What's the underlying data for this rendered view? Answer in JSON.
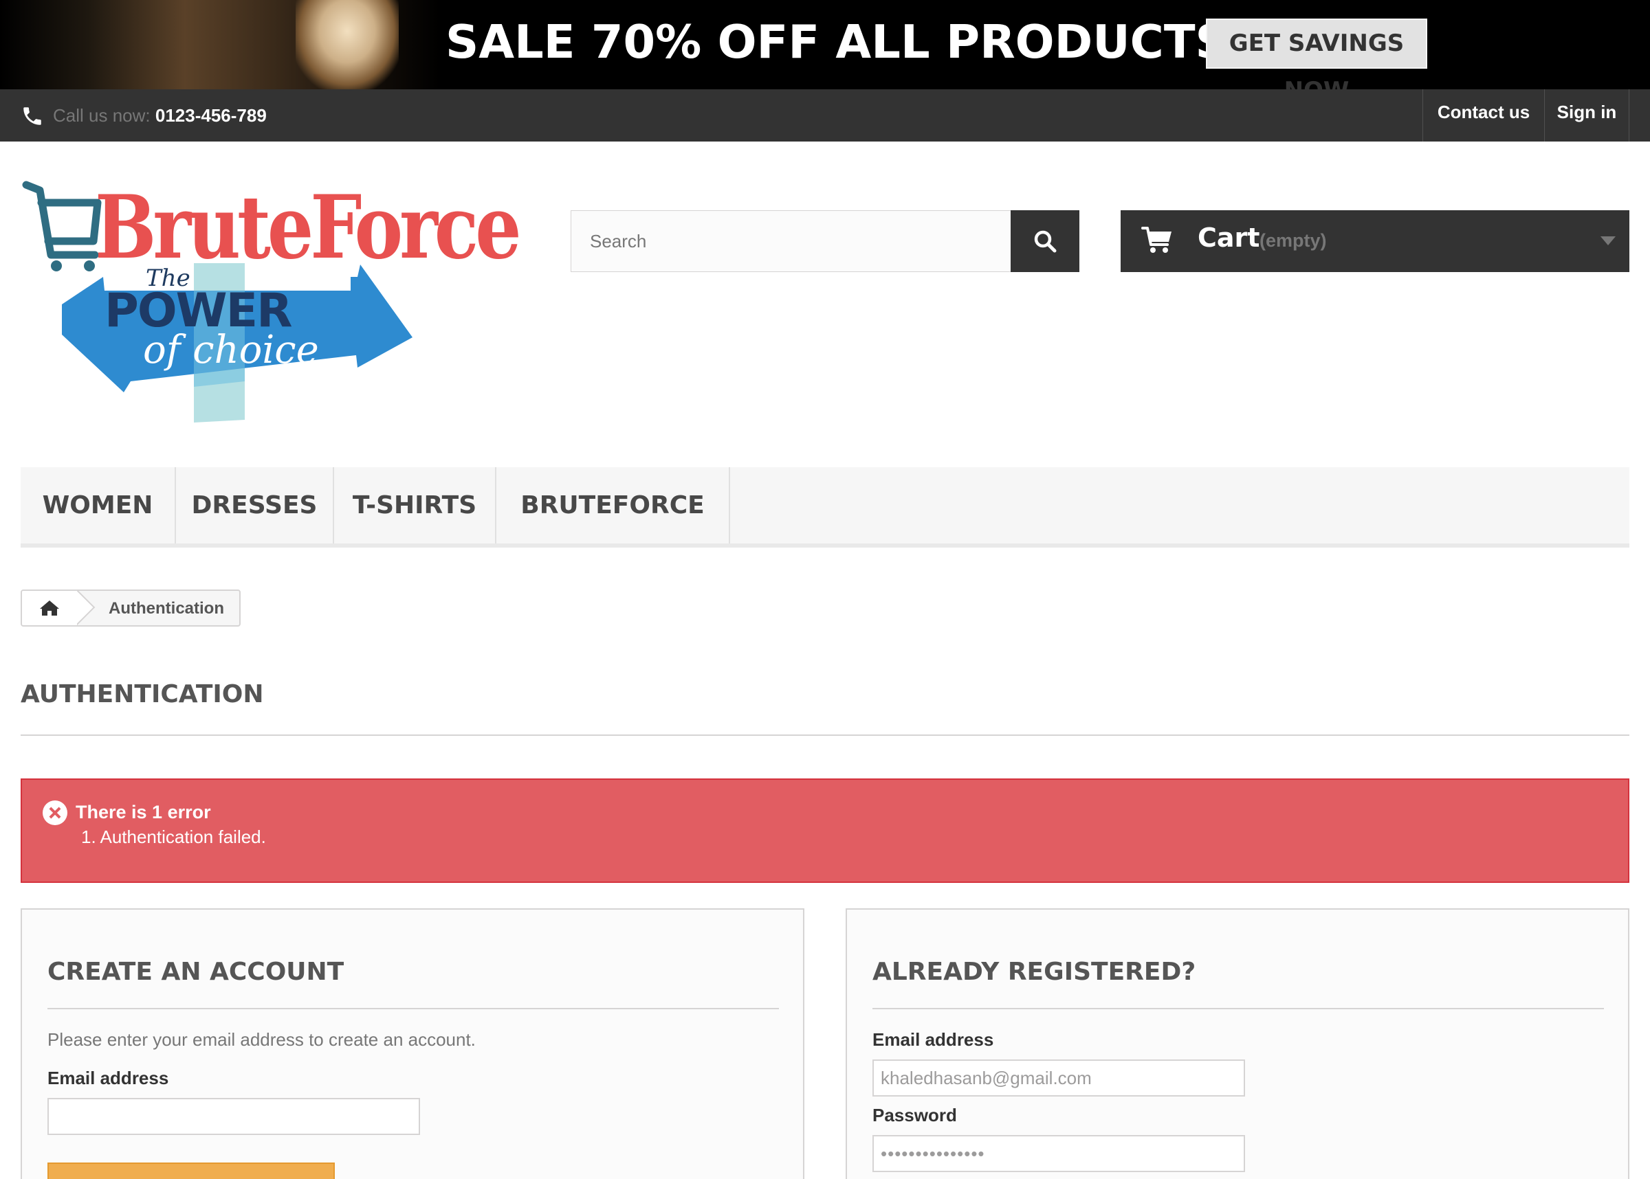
{
  "banner": {
    "headline": "SALE 70% OFF ALL PRODUCTS",
    "button_label": "GET SAVINGS NOW"
  },
  "topnav": {
    "call_label": "Call us now:",
    "phone": "0123-456-789",
    "contact_label": "Contact us",
    "signin_label": "Sign in"
  },
  "logo": {
    "brand": "BruteForce",
    "tagline_the": "The",
    "tagline_power": "POWER",
    "tagline_choice": "of choice"
  },
  "search": {
    "placeholder": "Search",
    "icon": "search-icon"
  },
  "cart": {
    "label": "Cart",
    "status": "(empty)",
    "icon": "shopping-cart-icon"
  },
  "menu": {
    "items": [
      "WOMEN",
      "DRESSES",
      "T-SHIRTS",
      "BRUTEFORCE"
    ]
  },
  "breadcrumb": {
    "home_icon": "home-icon",
    "current": "Authentication"
  },
  "page": {
    "heading": "AUTHENTICATION"
  },
  "alert": {
    "title": "There is 1 error",
    "items": [
      "1. Authentication failed."
    ],
    "color": "#e15d62"
  },
  "create_account": {
    "title": "CREATE AN ACCOUNT",
    "description": "Please enter your email address to create an account.",
    "email_label": "Email address",
    "email_value": "",
    "button_color": "#f0ad4e"
  },
  "registered": {
    "title": "ALREADY REGISTERED?",
    "email_label": "Email address",
    "email_value": "khaledhasanb@gmail.com",
    "password_label": "Password",
    "password_value": "•••••••••••••••"
  },
  "colors": {
    "dark_bar": "#333333",
    "logo_red": "#e85150",
    "logo_blue": "#1d3a66"
  }
}
